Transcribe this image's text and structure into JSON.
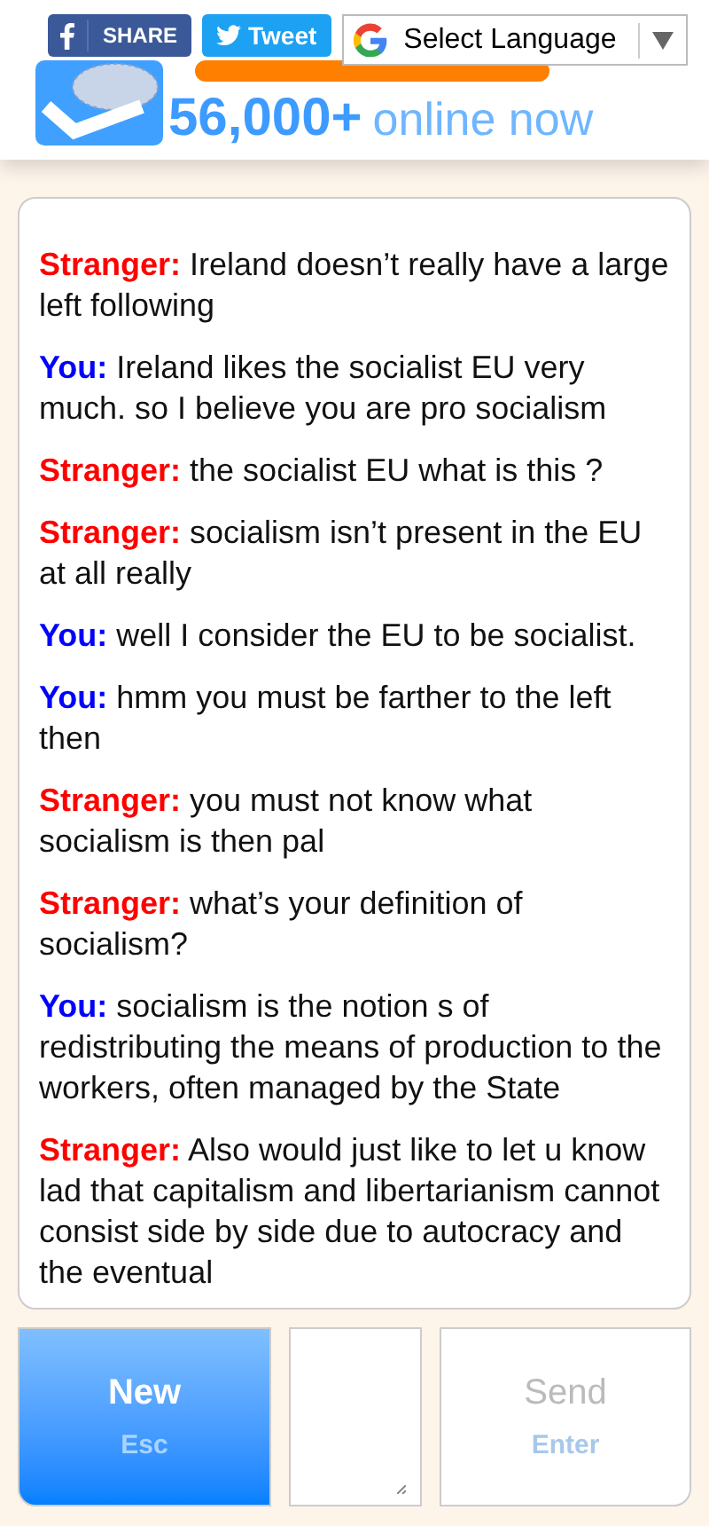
{
  "header": {
    "share_buttons": [
      {
        "kind": "facebook",
        "label": "SHARE"
      },
      {
        "kind": "twitter",
        "label": "Tweet"
      }
    ],
    "language_select": {
      "value": "Select Language"
    },
    "online_count": {
      "number": "56,000+",
      "label": "online now"
    }
  },
  "chat": {
    "messages": [
      {
        "sender": "Stranger:",
        "from_stranger": true,
        "text": "Ireland doesn’t really have a large left following"
      },
      {
        "sender": "You:",
        "from_stranger": false,
        "text": "Ireland likes the socialist EU very much. so I believe you are pro socialism"
      },
      {
        "sender": "Stranger:",
        "from_stranger": true,
        "text": "the socialist EU what is this ?"
      },
      {
        "sender": "Stranger:",
        "from_stranger": true,
        "text": "socialism isn’t present in the EU at all really"
      },
      {
        "sender": "You:",
        "from_stranger": false,
        "text": "well I consider the EU to be socialist."
      },
      {
        "sender": "You:",
        "from_stranger": false,
        "text": "hmm you must be farther to the left then"
      },
      {
        "sender": "Stranger:",
        "from_stranger": true,
        "text": "you must not know what socialism is then pal"
      },
      {
        "sender": "Stranger:",
        "from_stranger": true,
        "text": "what’s your definition of socialism?"
      },
      {
        "sender": "You:",
        "from_stranger": false,
        "text": "socialism is the notion s of redistributing the means of production to the workers, often managed by the State"
      },
      {
        "sender": "Stranger:",
        "from_stranger": true,
        "text": "Also would just like to let u know lad that capitalism and libertarianism cannot consist side by side due to autocracy and the eventual"
      }
    ]
  },
  "controls": {
    "new_button": {
      "label": "New",
      "key": "Esc",
      "disabled": false
    },
    "send_button": {
      "label": "Send",
      "key": "Enter",
      "disabled": true
    }
  }
}
